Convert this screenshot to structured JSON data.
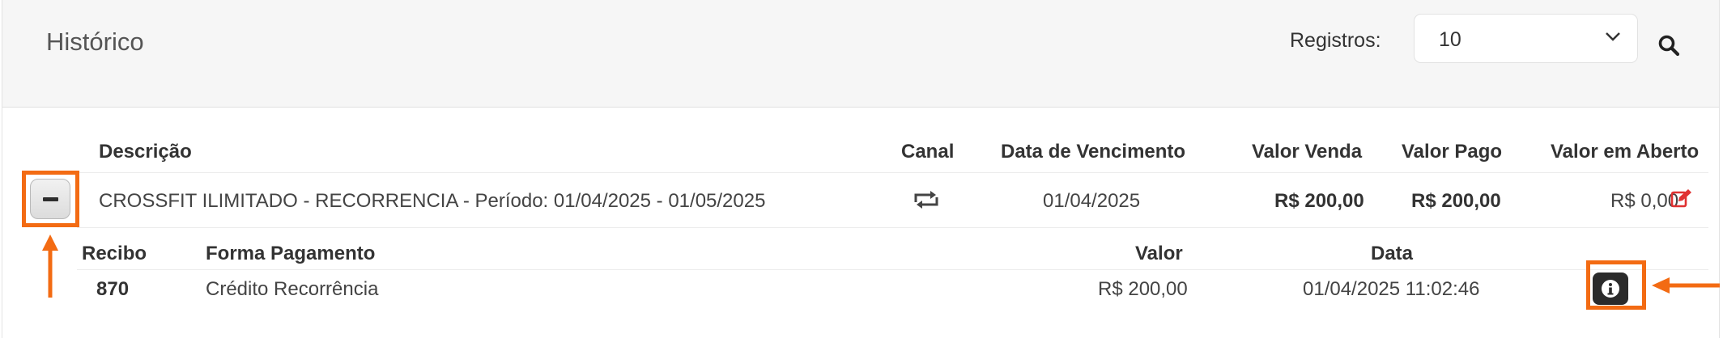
{
  "header": {
    "title": "Histórico",
    "records_label": "Registros:",
    "records_value": "10",
    "search_icon": "search-icon",
    "chevron_icon": "chevron-down-icon"
  },
  "table": {
    "columns": {
      "descricao": "Descrição",
      "canal": "Canal",
      "vencimento": "Data de Vencimento",
      "valor_venda": "Valor Venda",
      "valor_pago": "Valor Pago",
      "valor_aberto": "Valor em Aberto"
    },
    "row": {
      "descricao": "CROSSFIT ILIMITADO - RECORRENCIA - Período: 01/04/2025 - 01/05/2025",
      "canal_icon": "recurring-icon",
      "vencimento": "01/04/2025",
      "valor_venda": "R$ 200,00",
      "valor_pago": "R$ 200,00",
      "valor_aberto": "R$ 0,00",
      "edit_icon": "edit-icon"
    }
  },
  "detail": {
    "columns": {
      "recibo": "Recibo",
      "forma": "Forma Pagamento",
      "valor": "Valor",
      "data": "Data"
    },
    "row": {
      "recibo": "870",
      "forma": "Crédito Recorrência",
      "valor": "R$ 200,00",
      "data": "01/04/2025 11:02:46",
      "info_icon": "info-icon"
    }
  },
  "colors": {
    "highlight": "#f36b13",
    "edit": "#e03131",
    "header_bg": "#f6f6f6"
  }
}
